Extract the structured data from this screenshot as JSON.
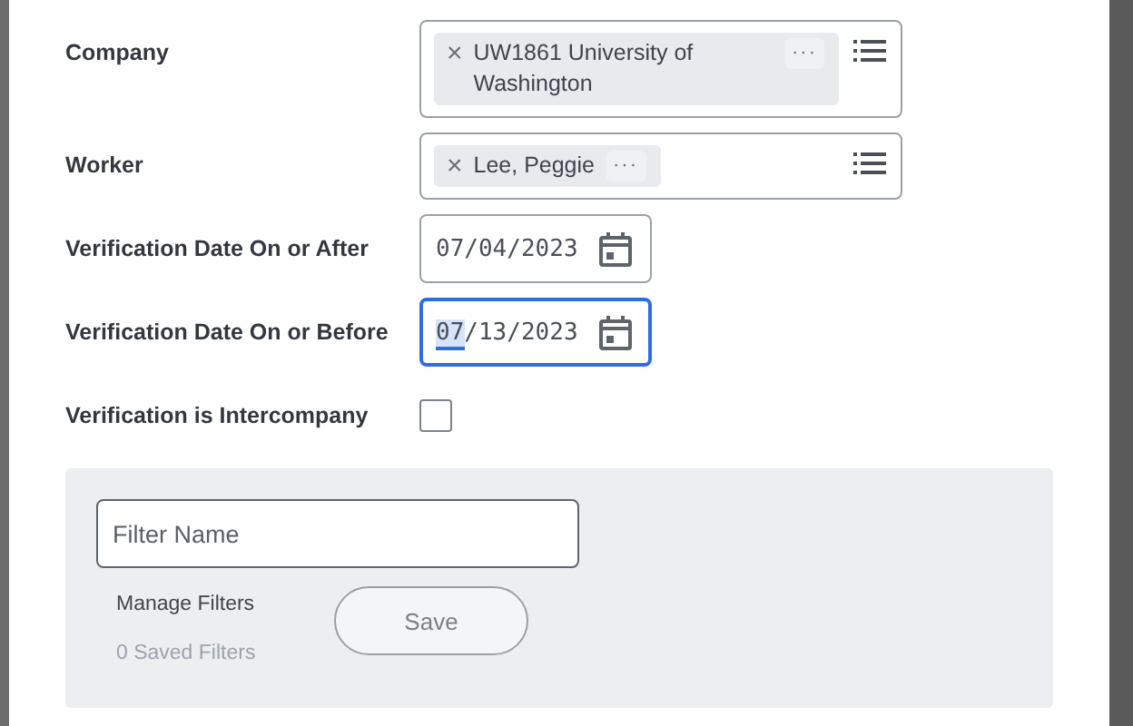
{
  "fields": [
    {
      "kind": "multiselect",
      "label": "Company",
      "pills": [
        {
          "remove": "×",
          "text": "UW1861 University of Washington",
          "more": "···"
        }
      ]
    },
    {
      "kind": "multiselect",
      "label": "Worker",
      "pills": [
        {
          "remove": "×",
          "text": "Lee, Peggie",
          "more": "···"
        }
      ]
    },
    {
      "kind": "date",
      "label": "Verification Date On or After",
      "value": "07/04/2023",
      "focused": false
    },
    {
      "kind": "date",
      "label": "Verification Date On or Before",
      "value": "07/13/2023",
      "focused": true
    },
    {
      "kind": "checkbox",
      "label": "Verification is Intercompany",
      "checked": false
    }
  ],
  "filter_panel": {
    "placeholder": "Filter Name",
    "manage": "Manage Filters",
    "saved_count": "0 Saved Filters",
    "save_button": "Save"
  }
}
